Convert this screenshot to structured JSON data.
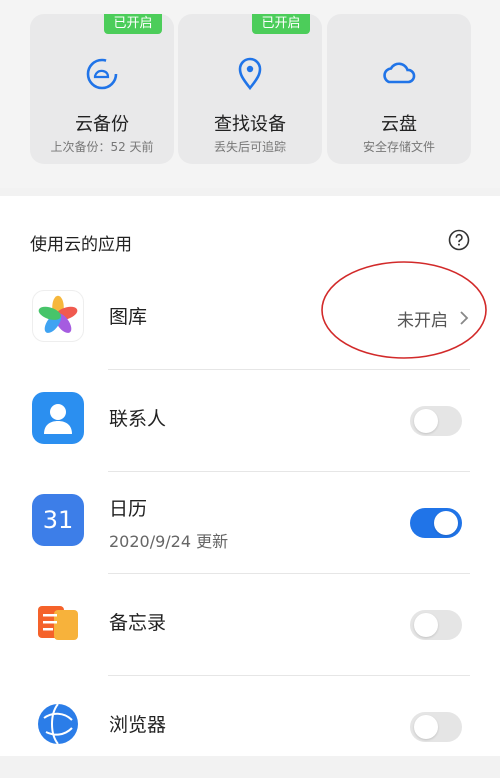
{
  "cards": [
    {
      "title": "云备份",
      "subtitle": "上次备份：52 天前",
      "badge": "已开启",
      "icon": "cloud-sync-icon"
    },
    {
      "title": "查找设备",
      "subtitle": "丢失后可追踪",
      "badge": "已开启",
      "icon": "location-pin-icon"
    },
    {
      "title": "云盘",
      "subtitle": "安全存储文件",
      "badge": "",
      "icon": "cloud-icon"
    }
  ],
  "section": {
    "title": "使用云的应用",
    "help_icon": "help-icon"
  },
  "apps": [
    {
      "name": "图库",
      "status": "未开启",
      "icon": "gallery-icon"
    },
    {
      "name": "联系人",
      "toggle": false,
      "icon": "contacts-icon"
    },
    {
      "name": "日历",
      "meta": "2020/9/24 更新",
      "toggle": true,
      "icon_text": "31",
      "icon": "calendar-icon"
    },
    {
      "name": "备忘录",
      "toggle": false,
      "icon": "notes-icon"
    },
    {
      "name": "浏览器",
      "toggle": false,
      "icon": "browser-icon"
    }
  ],
  "colors": {
    "badge": "#4ccd5a",
    "accent": "#2074e8",
    "annotation": "#d22a2a"
  }
}
